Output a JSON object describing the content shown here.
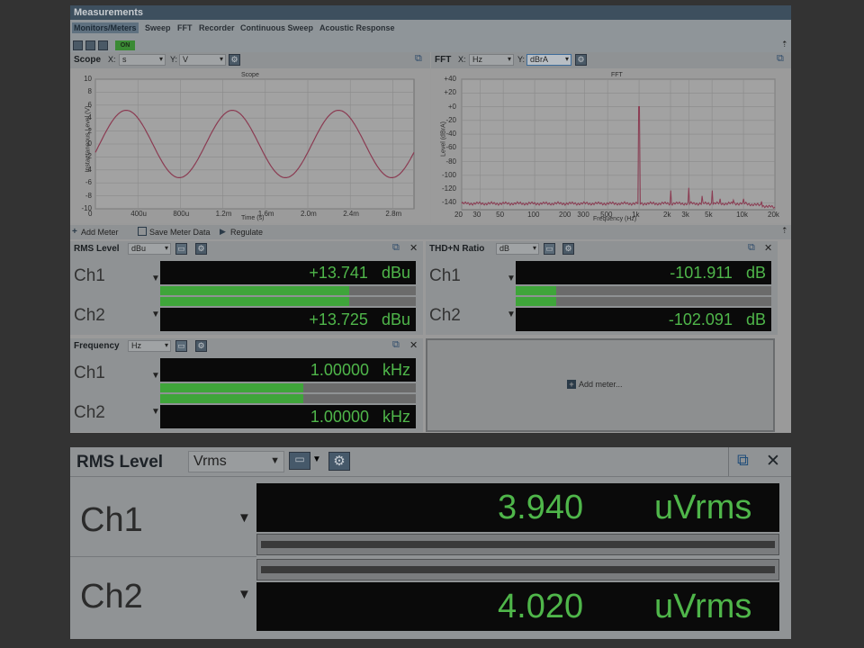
{
  "window": {
    "title": "Measurements"
  },
  "tabs": [
    "Monitors/Meters",
    "Sweep",
    "FFT",
    "Recorder",
    "Continuous Sweep",
    "Acoustic Response"
  ],
  "toolbar": {
    "on_label": "ON"
  },
  "scope": {
    "title": "Scope",
    "x_label": "X:",
    "x_unit": "s",
    "y_label": "Y:",
    "y_unit": "V",
    "plot_title": "Scope",
    "ylabel": "Instantaneous Level (V)",
    "xlabel": "Time (s)",
    "yticks": [
      "10",
      "8",
      "6",
      "4",
      "2",
      "0",
      "-2",
      "-4",
      "-6",
      "-8",
      "-10"
    ],
    "xticks": [
      "0",
      "400u",
      "800u",
      "1.2m",
      "1.6m",
      "2.0m",
      "2.4m",
      "2.8m"
    ]
  },
  "fft": {
    "title": "FFT",
    "x_label": "X:",
    "x_unit": "Hz",
    "y_label": "Y:",
    "y_unit": "dBrA",
    "plot_title": "FFT",
    "ylabel": "Level (dBrA)",
    "xlabel": "Frequency (Hz)",
    "yticks": [
      "+40",
      "+20",
      "+0",
      "-20",
      "-40",
      "-60",
      "-80",
      "-100",
      "-120",
      "-140"
    ],
    "xticks": [
      "20",
      "30",
      "50",
      "100",
      "200",
      "300",
      "500",
      "1k",
      "2k",
      "3k",
      "5k",
      "10k",
      "20k"
    ]
  },
  "meters_toolbar": {
    "add_meter": "Add Meter",
    "save": "Save Meter Data",
    "regulate": "Regulate"
  },
  "rms": {
    "title": "RMS Level",
    "unit_sel": "dBu",
    "rows": [
      {
        "ch": "Ch1",
        "value": "+13.741",
        "unit": "dBu",
        "level": 0.74
      },
      {
        "ch": "Ch2",
        "value": "+13.725",
        "unit": "dBu",
        "level": 0.74
      }
    ]
  },
  "thdn": {
    "title": "THD+N Ratio",
    "unit_sel": "dB",
    "rows": [
      {
        "ch": "Ch1",
        "value": "-101.911",
        "unit": "dB",
        "level": 0.16
      },
      {
        "ch": "Ch2",
        "value": "-102.091",
        "unit": "dB",
        "level": 0.16
      }
    ]
  },
  "freq": {
    "title": "Frequency",
    "unit_sel": "Hz",
    "rows": [
      {
        "ch": "Ch1",
        "value": "1.00000",
        "unit": "kHz",
        "level": 0.56
      },
      {
        "ch": "Ch2",
        "value": "1.00000",
        "unit": "kHz",
        "level": 0.56
      }
    ]
  },
  "add_meter_panel": {
    "label": "Add meter..."
  },
  "big_rms": {
    "title": "RMS Level",
    "unit_sel": "Vrms",
    "rows": [
      {
        "ch": "Ch1",
        "value": "3.940",
        "unit": "uVrms"
      },
      {
        "ch": "Ch2",
        "value": "4.020",
        "unit": "uVrms"
      }
    ]
  },
  "colors": {
    "meter_green": "#4fb64a",
    "bar_green": "#3fa53a",
    "trace": "#8b3b52"
  }
}
